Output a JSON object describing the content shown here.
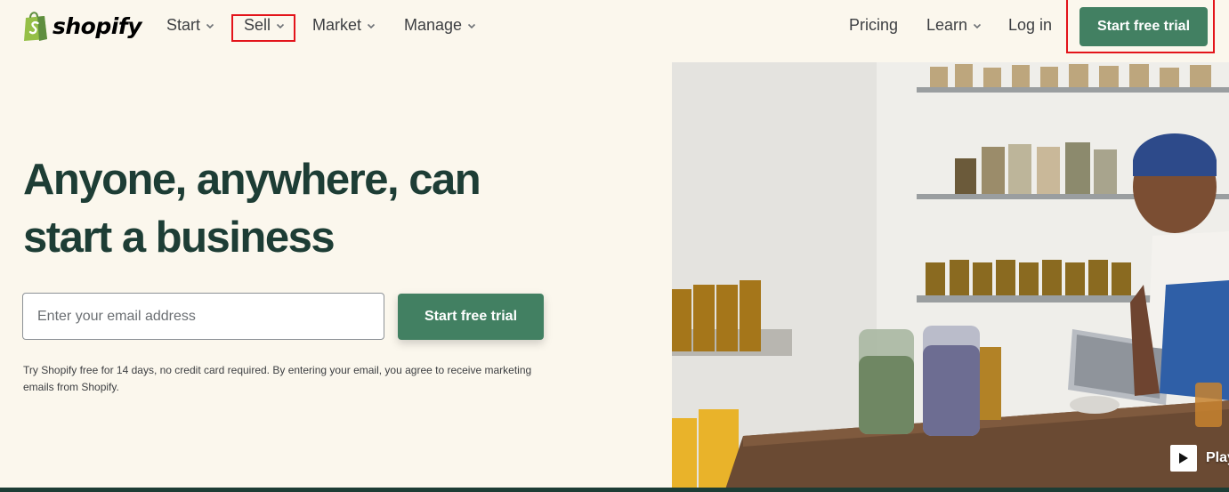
{
  "brand": {
    "name": "shopify",
    "color": "#95bf47"
  },
  "nav": {
    "start": "Start",
    "sell": "Sell",
    "market": "Market",
    "manage": "Manage",
    "pricing": "Pricing",
    "learn": "Learn",
    "login": "Log in",
    "cta": "Start free trial"
  },
  "hero": {
    "title": "Anyone, anywhere, can start a business",
    "email_placeholder": "Enter your email address",
    "cta": "Start free trial",
    "disclaimer": "Try Shopify free for 14 days, no credit card required. By entering your email, you agree to receive marketing emails from Shopify.",
    "video_label": "Play"
  },
  "colors": {
    "background": "#fbf7ed",
    "primary_button": "#428062",
    "heading": "#1d3d35",
    "highlight": "#e3141b"
  },
  "icons": {
    "logo": "shopping-bag-icon",
    "chevron": "chevron-down-icon",
    "play": "play-icon"
  }
}
